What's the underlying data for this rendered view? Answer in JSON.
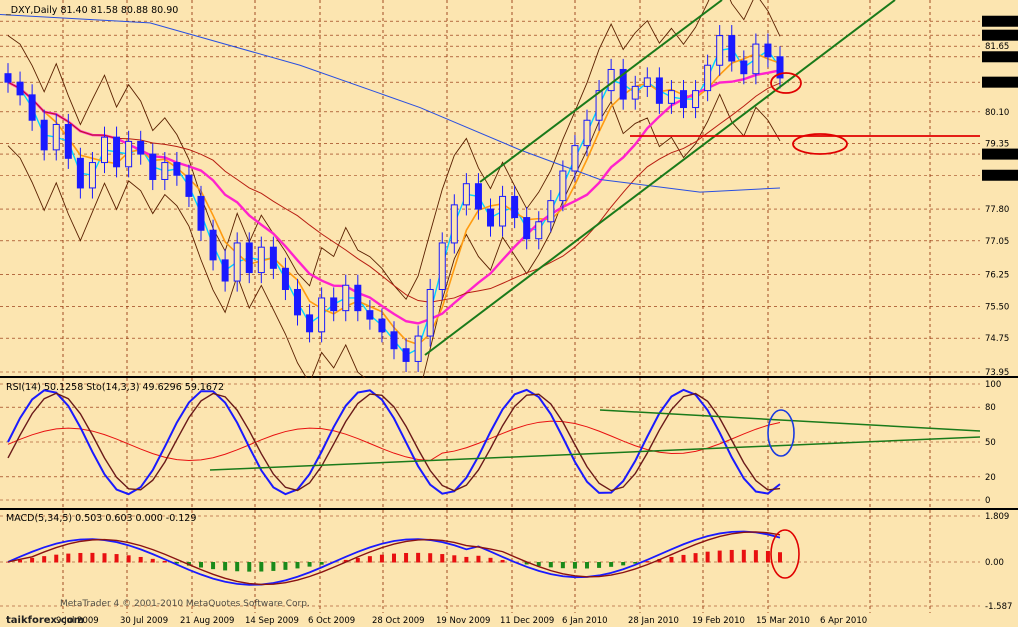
{
  "colors": {
    "panel_bg": "#FCE5B0",
    "grid": "#8B2500",
    "bull": "#1A1AFF",
    "bear": "#1A1AFF",
    "ma_fast": "#00D5FF",
    "ma_mid": "#FF9B10",
    "ma_slow": "#FF22CC",
    "ma_long": "#2A4FE0",
    "ma_red": "#B81E12",
    "bands": "#5A2000",
    "channel": "#1A7A1A",
    "support_red": "#E00000",
    "highlight": "#E00000",
    "rsi": "#E81010",
    "stoch_main": "#1A1AFF",
    "stoch_sig": "#6A1A1A",
    "macd_hist_up": "#E81010",
    "macd_hist_dn": "#1A8A1A",
    "macd_line": "#1A1AFF",
    "macd_sig": "#8A1212",
    "price_label_bg": "#000000",
    "price_label_fg": "#FFFFFF"
  },
  "chart_data": [
    {
      "type": "candlestick",
      "title": "_DXY,Daily  81.40 81.58 80.88 80.90",
      "symbol": "_DXY",
      "timeframe": "Daily",
      "ohlc": [
        81.4,
        81.58,
        80.88,
        80.9
      ],
      "ylim": [
        73.95,
        82.6
      ],
      "y_ticks": [
        82.24,
        81.91,
        81.65,
        81.4,
        80.8,
        80.1,
        79.35,
        79.1,
        78.6,
        77.8,
        77.05,
        76.25,
        75.5,
        74.75,
        73.95
      ],
      "highlighted_levels": [
        82.24,
        81.91,
        81.4,
        80.8,
        79.1,
        78.6
      ],
      "x_labels": [
        "9 Jul 2009",
        "30 Jul 2009",
        "21 Aug 2009",
        "14 Sep 2009",
        "6 Oct 2009",
        "28 Oct 2009",
        "19 Nov 2009",
        "11 Dec 2009",
        "6 Jan 2010",
        "28 Jan 2010",
        "19 Feb 2010",
        "15 Mar 2010",
        "6 Apr 2010"
      ],
      "close_series": [
        80.8,
        80.5,
        79.9,
        79.2,
        79.8,
        79.0,
        78.3,
        78.9,
        79.5,
        78.8,
        79.4,
        79.1,
        78.5,
        78.9,
        78.6,
        78.1,
        77.3,
        76.6,
        76.1,
        77.0,
        76.3,
        76.9,
        76.4,
        75.9,
        75.3,
        74.9,
        75.7,
        75.4,
        76.0,
        75.4,
        75.2,
        74.9,
        74.5,
        74.2,
        74.8,
        75.9,
        77.0,
        77.9,
        78.4,
        77.8,
        77.4,
        78.1,
        77.6,
        77.1,
        77.5,
        78.0,
        78.7,
        79.3,
        79.9,
        80.6,
        81.1,
        80.4,
        80.7,
        80.9,
        80.3,
        80.6,
        80.2,
        80.6,
        81.2,
        81.9,
        81.3,
        81.0,
        81.7,
        81.4,
        80.9
      ],
      "channel_lines": [
        {
          "name": "upper",
          "from": [
            "30 Nov 2009",
            78.8
          ],
          "to": [
            "1 Apr 2010",
            82.6
          ]
        },
        {
          "name": "lower",
          "from": [
            "25 Nov 2009",
            74.2
          ],
          "to": [
            "9 Apr 2010",
            81.0
          ]
        }
      ],
      "support_level": 79.55
    },
    {
      "type": "line",
      "title": "RSI(14) 50.1258  Sto(14,3,3) 49.6296 59.1672",
      "ylim": [
        0,
        100
      ],
      "y_ticks": [
        100,
        80,
        50,
        20,
        0
      ],
      "series": [
        {
          "name": "RSI(14)",
          "last": 50.1258
        },
        {
          "name": "Sto(14,3,3) %K",
          "last": 49.6296
        },
        {
          "name": "Sto(14,3,3) %D",
          "last": 59.1672
        }
      ]
    },
    {
      "type": "bar",
      "title": "MACD(5,34,5) 0.503 0.603 0.000 -0.129",
      "ylim": [
        -1.587,
        1.809
      ],
      "y_ticks": [
        1.809,
        0.0,
        -1.587
      ],
      "values_last": [
        0.503,
        0.603,
        0.0,
        -0.129
      ]
    }
  ],
  "watermark": {
    "brand": "taikforex.com",
    "metatrader": "MetaTrader 4 © 2001-2010 MetaQuotes Software Corp."
  }
}
